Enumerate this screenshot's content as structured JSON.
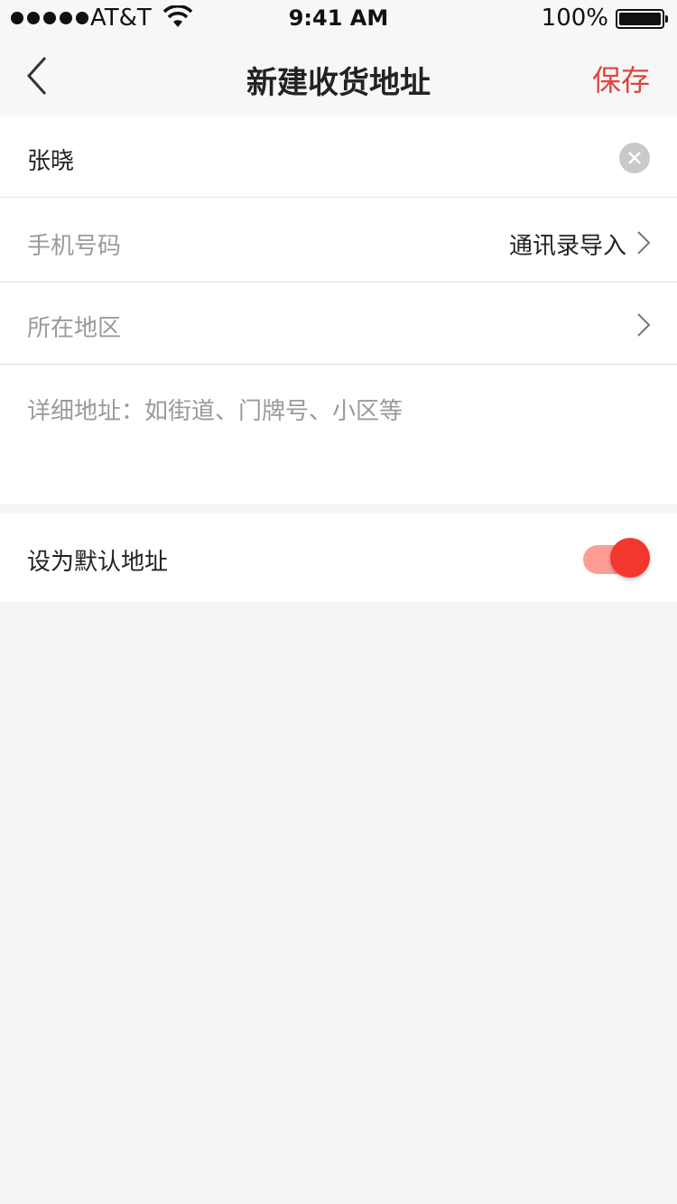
{
  "status_bar": {
    "carrier": "AT&T",
    "time": "9:41 AM",
    "battery": "100%"
  },
  "nav": {
    "title": "新建收货地址",
    "save_label": "保存",
    "back_icon": "chevron-left-icon"
  },
  "form": {
    "name_value": "张晓",
    "phone_placeholder": "手机号码",
    "contacts_import_label": "通讯录导入",
    "region_placeholder": "所在地区",
    "address_placeholder": "详细地址：如街道、门牌号、小区等"
  },
  "default_setting": {
    "label": "设为默认地址",
    "enabled": true
  },
  "colors": {
    "accent": "#e0453a",
    "toggle_knob": "#f2382e",
    "toggle_track": "#ff9d95",
    "background": "#f4f4f4"
  }
}
